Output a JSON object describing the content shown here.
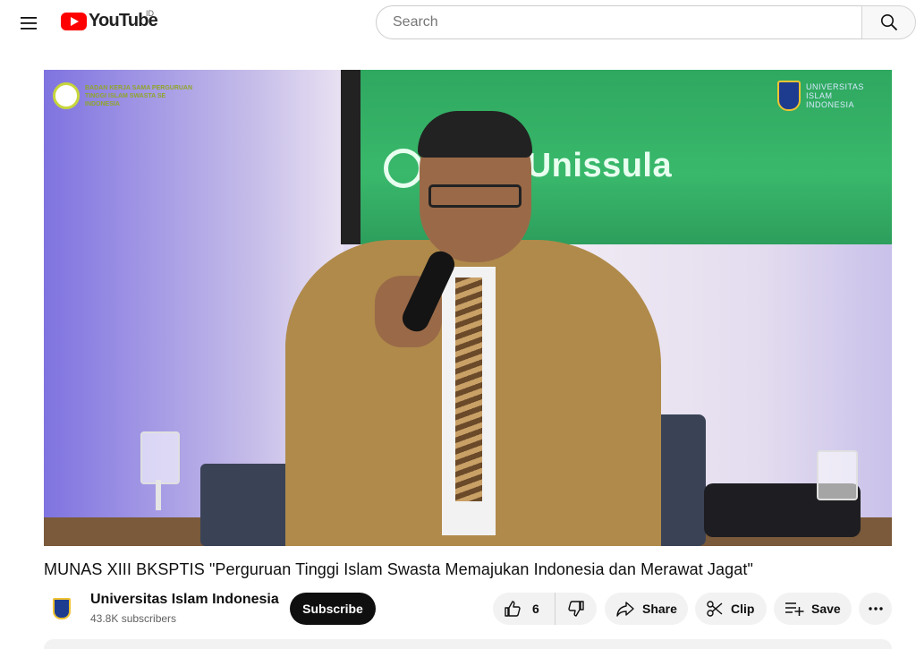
{
  "header": {
    "logo_text": "YouTube",
    "logo_country": "ID",
    "search_placeholder": "Search"
  },
  "video": {
    "screen_text": "YourUnissula",
    "overlay_org_text": "BADAN KERJA SAMA PERGURUAN TINGGI ISLAM SWASTA SE INDONESIA",
    "overlay_uii_text": "UNIVERSITAS ISLAM INDONESIA"
  },
  "meta": {
    "title": "MUNAS XIII BKSPTIS \"Perguruan Tinggi Islam Swasta Memajukan Indonesia dan Merawat Jagat\"",
    "channel_name": "Universitas Islam Indonesia",
    "subscribers": "43.8K subscribers",
    "subscribe_label": "Subscribe"
  },
  "actions": {
    "like_count": "6",
    "share_label": "Share",
    "clip_label": "Clip",
    "save_label": "Save"
  },
  "icons": {
    "menu": "hamburger-icon",
    "search": "magnifier-icon",
    "like": "thumbs-up-icon",
    "dislike": "thumbs-down-icon",
    "share": "share-arrow-icon",
    "clip": "scissors-icon",
    "save": "playlist-add-icon",
    "more": "more-dots-icon"
  },
  "colors": {
    "brand_red": "#ff0000",
    "subscribe_bg": "#0f0f0f",
    "pill_bg": "#f2f2f2"
  }
}
